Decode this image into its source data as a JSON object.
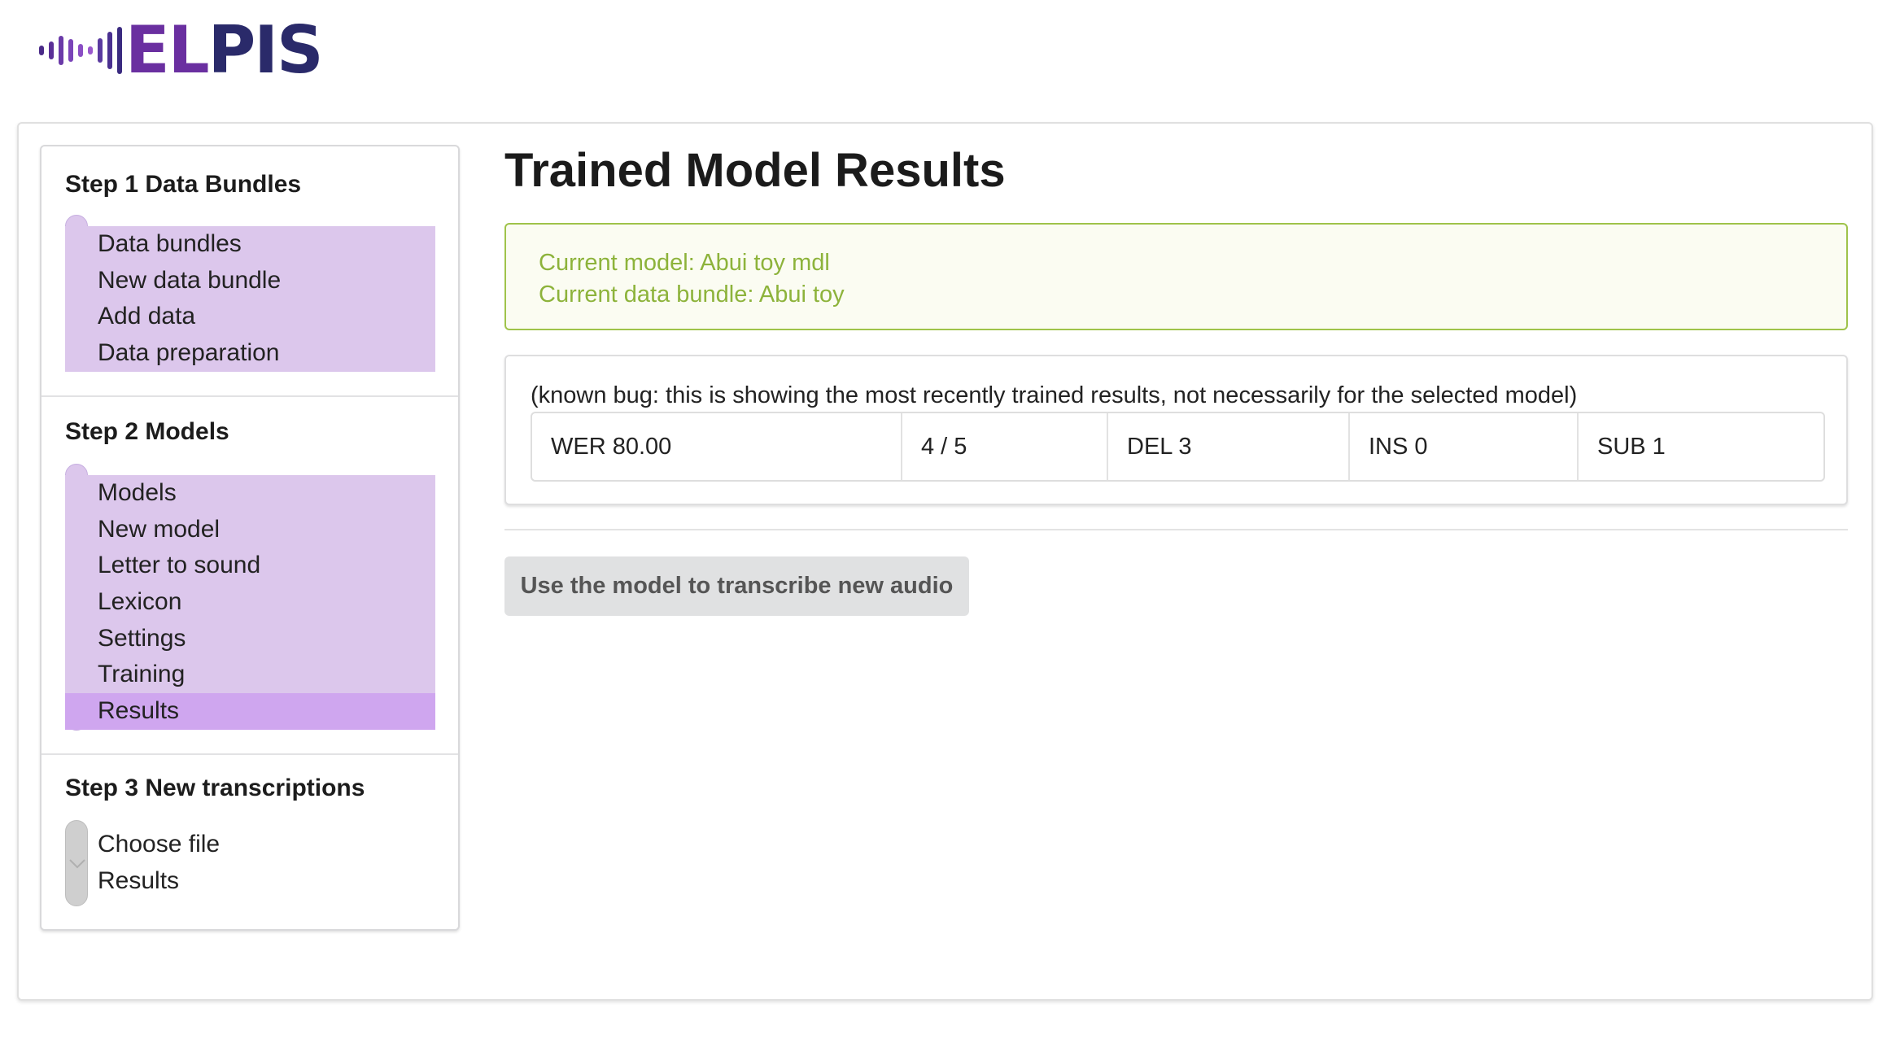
{
  "logo": {
    "text_a": "EL",
    "text_b": "PIS",
    "colors": {
      "purple": "#6a2fa0",
      "navy": "#2a2a6a"
    }
  },
  "sidebar": {
    "steps": [
      {
        "title": "Step 1 Data Bundles",
        "rail_color": "#dcc7ec",
        "items": [
          {
            "label": "Data bundles",
            "state": "done"
          },
          {
            "label": "New data bundle",
            "state": "done"
          },
          {
            "label": "Add data",
            "state": "done"
          },
          {
            "label": "Data preparation",
            "state": "done"
          }
        ]
      },
      {
        "title": "Step 2 Models",
        "rail_color": "#dcc7ec",
        "items": [
          {
            "label": "Models",
            "state": "done"
          },
          {
            "label": "New model",
            "state": "done"
          },
          {
            "label": "Letter to sound",
            "state": "done"
          },
          {
            "label": "Lexicon",
            "state": "done"
          },
          {
            "label": "Settings",
            "state": "done"
          },
          {
            "label": "Training",
            "state": "done"
          },
          {
            "label": "Results",
            "state": "active"
          }
        ]
      },
      {
        "title": "Step 3 New transcriptions",
        "rail_color": "#cfcfcf",
        "items": [
          {
            "label": "Choose file",
            "state": "todo"
          },
          {
            "label": "Results",
            "state": "todo"
          }
        ]
      }
    ]
  },
  "main": {
    "title": "Trained Model Results",
    "info": {
      "current_model": "Current model: Abui toy mdl",
      "current_bundle": "Current data bundle: Abui toy",
      "accent_color": "#8db33b"
    },
    "results": {
      "note": "(known bug: this is showing the most recently trained results, not necessarily for the selected model)",
      "cells": [
        "WER 80.00",
        "4 / 5",
        "DEL 3",
        "INS 0",
        "SUB 1"
      ]
    },
    "transcribe_button": "Use the model to transcribe new audio"
  }
}
